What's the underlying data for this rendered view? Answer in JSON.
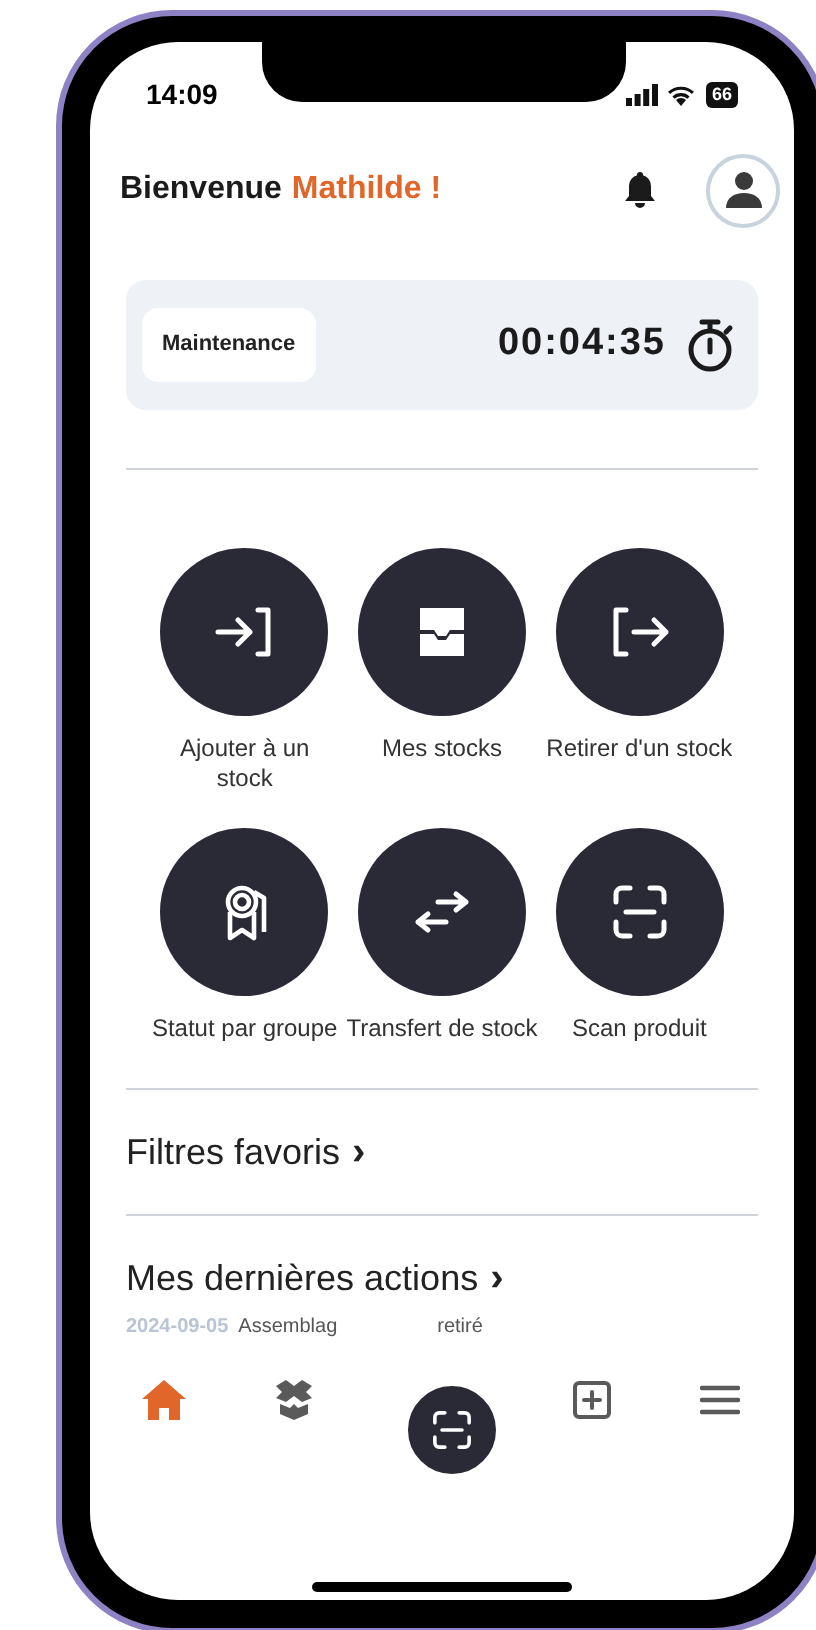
{
  "status_bar": {
    "time": "14:09",
    "battery": "66"
  },
  "header": {
    "greeting": "Bienvenue",
    "name": "Mathilde !"
  },
  "timer_card": {
    "label": "Maintenance",
    "elapsed": "00:04:35"
  },
  "actions": [
    {
      "kind": "add",
      "label": "Ajouter à un stock"
    },
    {
      "kind": "stocks",
      "label": "Mes stocks"
    },
    {
      "kind": "remove",
      "label": "Retirer d'un stock"
    },
    {
      "kind": "status",
      "label": "Statut par groupe"
    },
    {
      "kind": "transfer",
      "label": "Transfert de stock"
    },
    {
      "kind": "scan",
      "label": "Scan produit"
    }
  ],
  "sections": [
    {
      "title": "Filtres favoris",
      "chevron": "›"
    },
    {
      "title": "Mes dernières actions",
      "chevron": "›"
    }
  ],
  "last_action": {
    "date": "2024-09-05",
    "text_before": "Assemblag",
    "text_after": "retiré"
  },
  "bottom_nav": [
    {
      "kind": "home",
      "selected": true
    },
    {
      "kind": "stocks",
      "selected": false
    },
    {
      "kind": "add",
      "selected": false
    },
    {
      "kind": "menu",
      "selected": false
    }
  ]
}
